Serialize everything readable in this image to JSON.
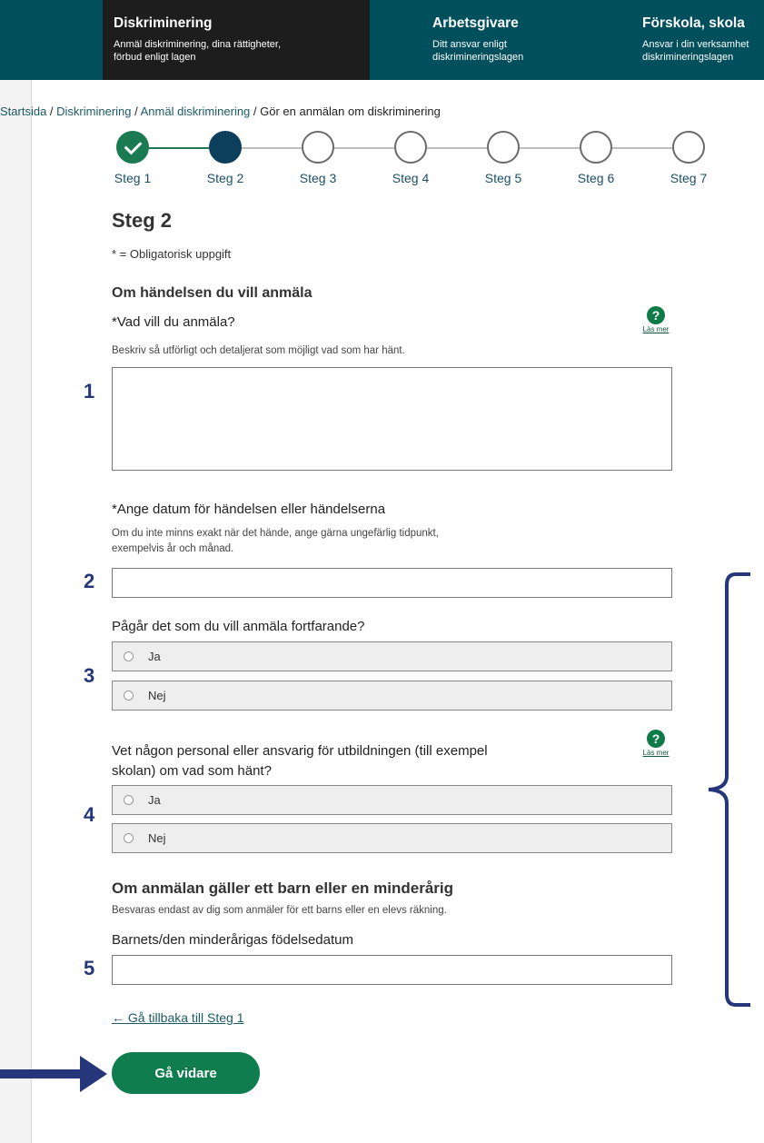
{
  "nav": [
    {
      "title": "Diskriminering",
      "subtitle": "Anmäl diskriminering, dina rättigheter,\nförbud enligt lagen"
    },
    {
      "title": "Arbetsgivare",
      "subtitle": "Ditt ansvar enligt\ndiskrimineringslagen"
    },
    {
      "title": "Förskola, skola",
      "subtitle": "Ansvar i din verksamhet\ndiskrimineringslagen"
    }
  ],
  "breadcrumb": {
    "home": "Startsida",
    "section": "Diskriminering",
    "page": "Anmäl diskriminering",
    "current": "Gör en anmälan om diskriminering",
    "separator": " / "
  },
  "steps": [
    {
      "label": "Steg 1",
      "state": "done"
    },
    {
      "label": "Steg 2",
      "state": "current"
    },
    {
      "label": "Steg 3",
      "state": "todo"
    },
    {
      "label": "Steg 4",
      "state": "todo"
    },
    {
      "label": "Steg 5",
      "state": "todo"
    },
    {
      "label": "Steg 6",
      "state": "todo"
    },
    {
      "label": "Steg 7",
      "state": "todo"
    }
  ],
  "form": {
    "heading": "Steg 2",
    "required_note": "* = Obligatorisk uppgift",
    "section1": "Om händelsen du vill anmäla",
    "q1_label": "*Vad vill du anmäla?",
    "q1_hint": "Beskriv så utförligt och detaljerat som möjligt vad som har hänt.",
    "q1_value": "",
    "q2_label": "*Ange datum för händelsen eller händelserna",
    "q2_hint": "Om du inte minns exakt när det hände, ange gärna ungefärlig tidpunkt,\nexempelvis år och månad.",
    "q2_value": "",
    "q3_label": "Pågår det som du vill anmäla fortfarande?",
    "q3_options": [
      "Ja",
      "Nej"
    ],
    "q4_label": "Vet någon personal eller ansvarig för utbildningen (till exempel\nskolan) om vad som hänt?",
    "q4_options": [
      "Ja",
      "Nej"
    ],
    "section2": "Om anmälan gäller ett barn eller en minderårig",
    "section2_hint": "Besvaras endast av dig som anmäler för ett barns eller en elevs räkning.",
    "q5_label": "Barnets/den minderårigas födelsedatum",
    "q5_value": "",
    "help_icon": "?",
    "help_link": "Läs mer",
    "back_link": "← Gå tillbaka till Steg 1",
    "submit": "Gå vidare"
  },
  "annotations": {
    "numbers": [
      "1",
      "2",
      "3",
      "4",
      "5"
    ],
    "color": "#25377a"
  },
  "colors": {
    "nav_bg": "#004f5d",
    "nav_active": "#1d1d1d",
    "accent_green": "#0f7d4d",
    "step_current": "#0c3f5b"
  }
}
